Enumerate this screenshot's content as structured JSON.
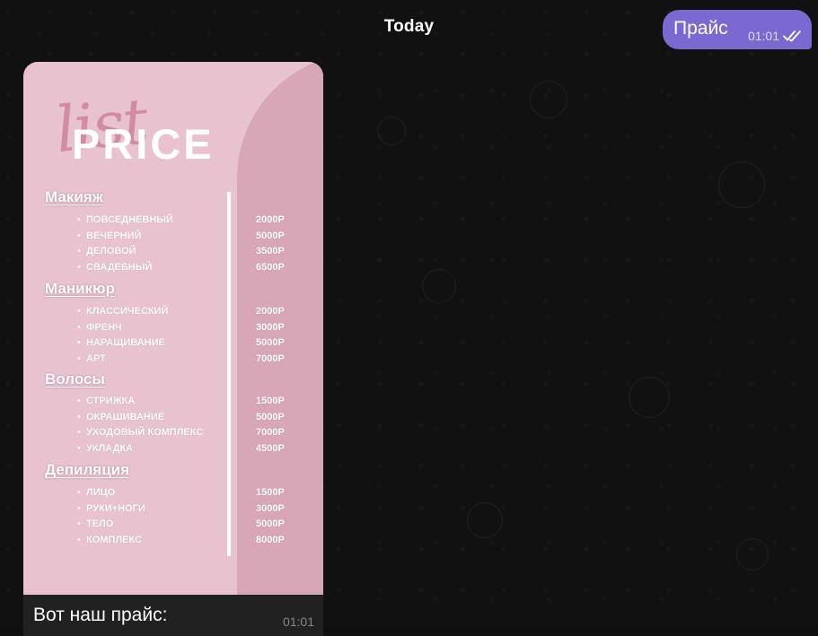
{
  "date_separator": "Today",
  "outgoing_message": {
    "text": "Прайс",
    "time": "01:01",
    "status_icon": "double-check-icon"
  },
  "incoming_message": {
    "caption": "Вот наш прайс:",
    "time": "01:01",
    "image": {
      "script_word": "list",
      "title": "PRICE",
      "sections": [
        {
          "title": "Макияж",
          "items": [
            {
              "name": "ПОВСЕДНЕВНЫЙ",
              "price": "2000Р"
            },
            {
              "name": "ВЕЧЕРНИЙ",
              "price": "5000Р"
            },
            {
              "name": "ДЕЛОВОЙ",
              "price": "3500Р"
            },
            {
              "name": "СВАДЕБНЫЙ",
              "price": "6500Р"
            }
          ]
        },
        {
          "title": "Маникюр",
          "items": [
            {
              "name": "КЛАССИЧЕСКИЙ",
              "price": "2000Р"
            },
            {
              "name": "ФРЕНЧ",
              "price": "3000Р"
            },
            {
              "name": "НАРАЩИВАНИЕ",
              "price": "5000Р"
            },
            {
              "name": "АРТ",
              "price": "7000Р"
            }
          ]
        },
        {
          "title": "Волосы",
          "items": [
            {
              "name": "СТРИЖКА",
              "price": "1500Р"
            },
            {
              "name": "ОКРАШИВАНИЕ",
              "price": "5000Р"
            },
            {
              "name": "УХОДОВЫЙ КОМПЛЕКС",
              "price": "7000Р"
            },
            {
              "name": "УКЛАДКА",
              "price": "4500Р"
            }
          ]
        },
        {
          "title": "Депиляция",
          "items": [
            {
              "name": "ЛИЦО",
              "price": "1500Р"
            },
            {
              "name": "РУКИ+НОГИ",
              "price": "3000Р"
            },
            {
              "name": "ТЕЛО",
              "price": "5000Р"
            },
            {
              "name": "КОМПЛЕКС",
              "price": "8000Р"
            }
          ]
        }
      ]
    }
  },
  "colors": {
    "outgoing_bubble": "#7b68d1",
    "card_pink": "#e8c3cf",
    "card_arc": "#d7a6b7",
    "chat_background": "#111111",
    "incoming_bubble": "#212121"
  }
}
